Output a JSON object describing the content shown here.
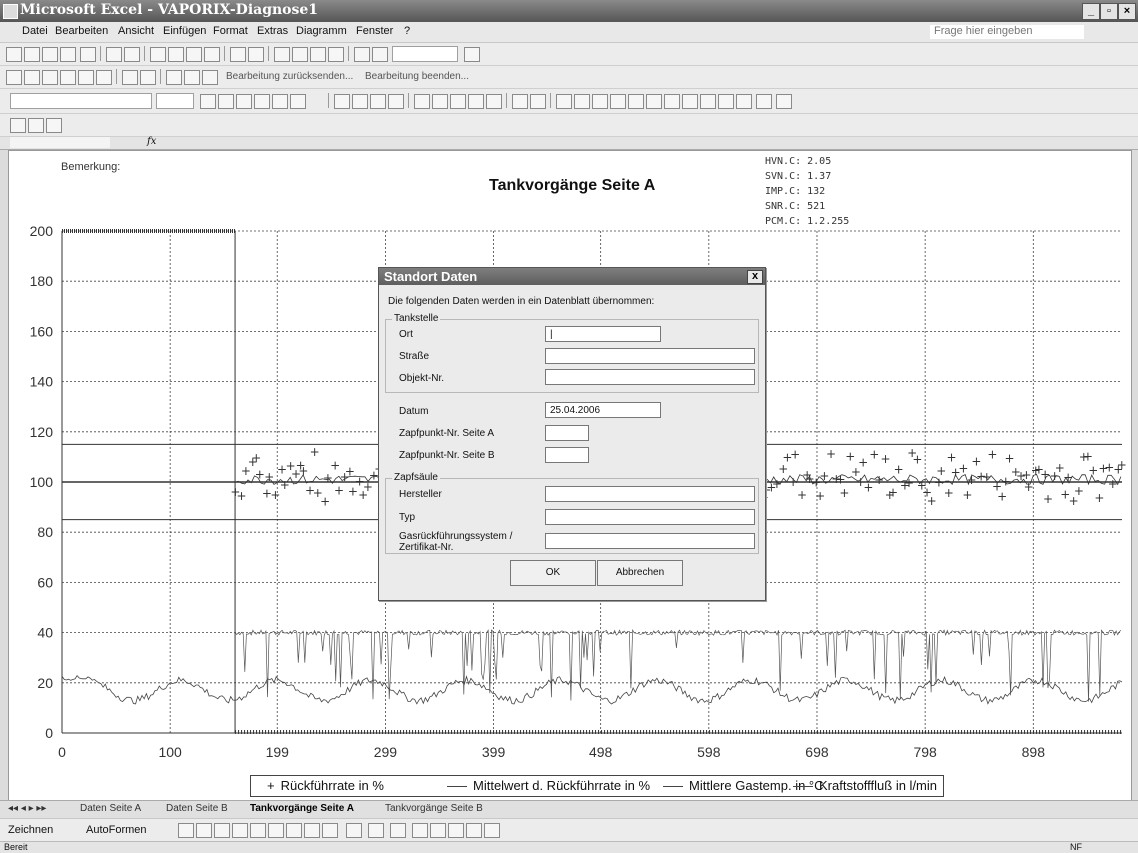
{
  "window": {
    "title": "Microsoft Excel - VAPORIX-Diagnose1"
  },
  "menu": {
    "items": [
      "Datei",
      "Bearbeiten",
      "Ansicht",
      "Einfügen",
      "Format",
      "Extras",
      "Diagramm",
      "Fenster",
      "?"
    ],
    "help_placeholder": "Frage hier eingeben"
  },
  "toolbar": {
    "review_send": "Bearbeitung zurücksenden...",
    "review_end": "Bearbeitung beenden..."
  },
  "formula": {
    "fx": "fx"
  },
  "chart": {
    "remark_label": "Bemerkung:",
    "info_lines": [
      "HVN.C: 2.05",
      "SVN.C: 1.37",
      "IMP.C: 132",
      "SNR.C: 521",
      "PCM.C: 1.2.255"
    ]
  },
  "chart_data": {
    "type": "line",
    "title": "Tankvorgänge Seite A",
    "xlabel": "",
    "ylabel": "",
    "x_ticks": [
      "0",
      "100",
      "199",
      "299",
      "399",
      "498",
      "598",
      "698",
      "798",
      "898"
    ],
    "y_ticks": [
      "0",
      "20",
      "40",
      "60",
      "80",
      "100",
      "120",
      "140",
      "160",
      "180",
      "200"
    ],
    "ylim": [
      0,
      200
    ],
    "xlim": [
      0,
      980
    ],
    "reference_lines": [
      115,
      100,
      85
    ],
    "grid": true,
    "legend_position": "bottom",
    "series": [
      {
        "name": "Rückführrate in %",
        "marker": "+",
        "approx_level": 102,
        "x_range": [
          160,
          980
        ]
      },
      {
        "name": "Mittelwert d. Rückführrate in %",
        "approx_level": 101,
        "x_range": [
          160,
          980
        ]
      },
      {
        "name": "Mittlere Gastemp. in °C",
        "approx_level": 17,
        "x_range": [
          0,
          980
        ]
      },
      {
        "name": "Kraftstofffluß in l/min",
        "approx_level": 40,
        "x_range": [
          160,
          980
        ]
      }
    ]
  },
  "dialog": {
    "title": "Standort Daten",
    "close": "x",
    "intro": "Die folgenden Daten werden in ein Datenblatt übernommen:",
    "group_station": "Tankstelle",
    "ort_label": "Ort",
    "ort_value": "|",
    "strasse_label": "Straße",
    "objekt_label": "Objekt-Nr.",
    "datum_label": "Datum",
    "datum_value": "25.04.2006",
    "zapf_a_label": "Zapfpunkt-Nr. Seite A",
    "zapf_b_label": "Zapfpunkt-Nr. Seite B",
    "group_pump": "Zapfsäule",
    "hersteller_label": "Hersteller",
    "typ_label": "Typ",
    "gas_label_1": "Gasrückführungssystem /",
    "gas_label_2": "Zertifikat-Nr.",
    "ok": "OK",
    "cancel": "Abbrechen"
  },
  "tabs": [
    "Daten Seite A",
    "Daten Seite B",
    "Tankvorgänge Seite A",
    "Tankvorgänge Seite B"
  ],
  "active_tab": "Tankvorgänge Seite A",
  "drawbar": {
    "draw": "Zeichnen",
    "autoshapes": "AutoFormen"
  },
  "status": {
    "left": "Bereit",
    "right": "NF"
  }
}
